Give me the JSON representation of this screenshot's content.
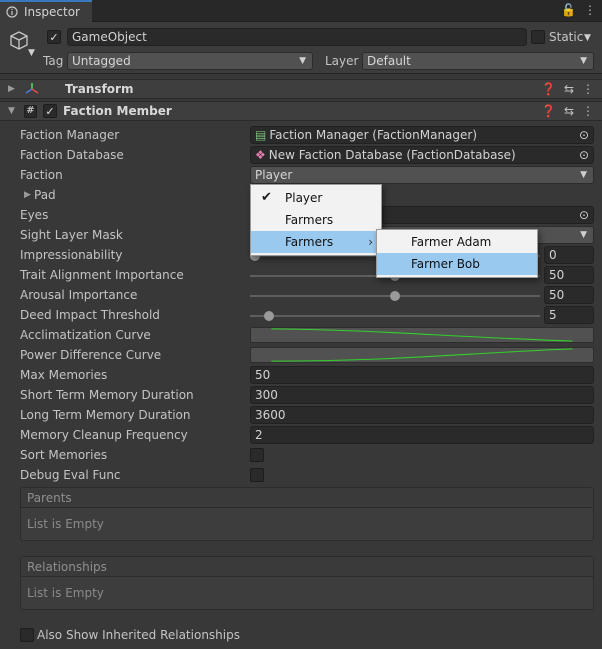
{
  "window": {
    "tab_label": "Inspector",
    "lock_glyph": "🔓",
    "menu_glyph": "⋮"
  },
  "gameobject": {
    "name": "GameObject",
    "static_label": "Static",
    "tag_label": "Tag",
    "tag_value": "Untagged",
    "layer_label": "Layer",
    "layer_value": "Default"
  },
  "components": {
    "transform": {
      "title": "Transform"
    },
    "faction_member": {
      "title": "Faction Member"
    }
  },
  "fields": {
    "faction_manager": {
      "label": "Faction Manager",
      "value": "Faction Manager (FactionManager)"
    },
    "faction_database": {
      "label": "Faction Database",
      "value": "New Faction Database (FactionDatabase)"
    },
    "faction": {
      "label": "Faction",
      "value": "Player"
    },
    "pad": {
      "label": "Pad"
    },
    "eyes": {
      "label": "Eyes"
    },
    "sight_layer_mask": {
      "label": "Sight Layer Mask"
    },
    "impressionability": {
      "label": "Impressionability",
      "value": "0",
      "fraction": 0.0
    },
    "trait_alignment": {
      "label": "Trait Alignment Importance",
      "value": "50",
      "fraction": 0.5
    },
    "arousal": {
      "label": "Arousal Importance",
      "value": "50",
      "fraction": 0.5
    },
    "deed_impact": {
      "label": "Deed Impact Threshold",
      "value": "5",
      "fraction": 0.05
    },
    "acclimatization_curve": {
      "label": "Acclimatization Curve"
    },
    "power_difference_curve": {
      "label": "Power Difference Curve"
    },
    "max_memories": {
      "label": "Max Memories",
      "value": "50"
    },
    "short_term": {
      "label": "Short Term Memory Duration",
      "value": "300"
    },
    "long_term": {
      "label": "Long Term Memory Duration",
      "value": "3600"
    },
    "cleanup_freq": {
      "label": "Memory Cleanup Frequency",
      "value": "2"
    },
    "sort_memories": {
      "label": "Sort Memories"
    },
    "debug_eval": {
      "label": "Debug Eval Func"
    }
  },
  "lists": {
    "parents": {
      "header": "Parents",
      "empty": "List is Empty"
    },
    "relationships": {
      "header": "Relationships",
      "empty": "List is Empty"
    }
  },
  "footer": {
    "inherited_label": "Also Show Inherited Relationships"
  },
  "faction_menu": {
    "items": [
      {
        "label": "Player",
        "checked": true
      },
      {
        "label": "Farmers"
      },
      {
        "label": "Farmers",
        "has_submenu": true
      }
    ],
    "submenu": [
      {
        "label": "Farmer Adam"
      },
      {
        "label": "Farmer Bob"
      }
    ]
  },
  "colors": {
    "accent_blue": "#3a79bb",
    "menu_highlight": "#99c9ef",
    "curve_green": "#31d12a"
  }
}
